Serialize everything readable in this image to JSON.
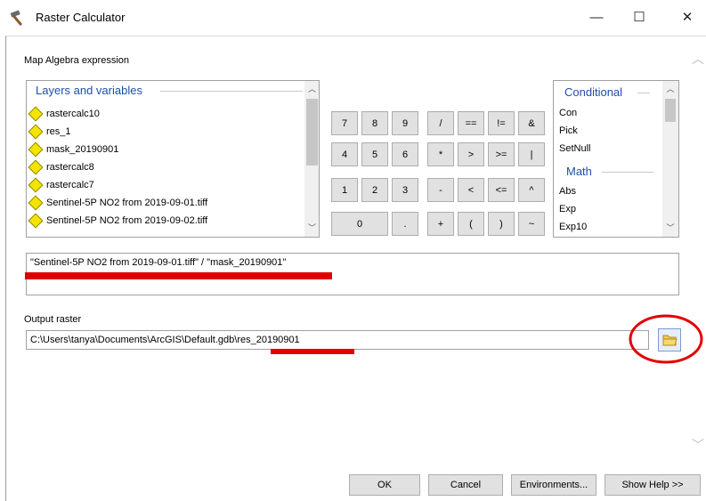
{
  "window": {
    "title": "Raster Calculator",
    "controls": {
      "minimize": "—",
      "maximize": "☐",
      "close": "✕"
    }
  },
  "expression_section": {
    "label": "Map Algebra expression"
  },
  "layers": {
    "header": "Layers and variables",
    "items": [
      "rastercalc10",
      "res_1",
      "mask_20190901",
      "rastercalc8",
      "rastercalc7",
      "Sentinel-5P NO2 from 2019-09-01.tiff",
      "Sentinel-5P NO2 from 2019-09-02.tiff"
    ]
  },
  "keypad": {
    "rows": [
      [
        "7",
        "8",
        "9",
        "/",
        "==",
        "!=",
        "&"
      ],
      [
        "4",
        "5",
        "6",
        "*",
        ">",
        ">=",
        "|"
      ],
      [
        "1",
        "2",
        "3",
        "-",
        "<",
        "<=",
        "^"
      ],
      [
        "0",
        ".",
        "+",
        "(",
        ")",
        "~"
      ]
    ]
  },
  "functions": {
    "group1": "Conditional",
    "group1_items": [
      "Con",
      "Pick",
      "SetNull"
    ],
    "group2": "Math",
    "group2_items": [
      "Abs",
      "Exp",
      "Exp10"
    ]
  },
  "expression": {
    "value": "\"Sentinel-5P NO2 from 2019-09-01.tiff\" / \"mask_20190901\""
  },
  "output": {
    "label": "Output raster",
    "value": "C:\\Users\\tanya\\Documents\\ArcGIS\\Default.gdb\\res_20190901"
  },
  "buttons": {
    "ok": "OK",
    "cancel": "Cancel",
    "environments": "Environments...",
    "help": "Show Help >>"
  },
  "colors": {
    "annotation_red": "#e10000",
    "group_header_blue": "#1f4ea8",
    "layer_icon": "#f5e400"
  },
  "icons": {
    "browse": "folder-open-icon",
    "layer": "layer-diamond-icon",
    "app": "hammer-icon"
  }
}
